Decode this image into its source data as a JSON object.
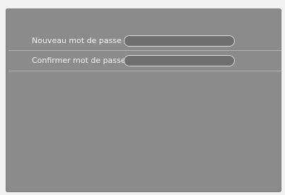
{
  "fields": [
    {
      "label": "Nouveau mot de passe",
      "value": ""
    },
    {
      "label": "Confirmer mot de passe",
      "value": ""
    }
  ]
}
